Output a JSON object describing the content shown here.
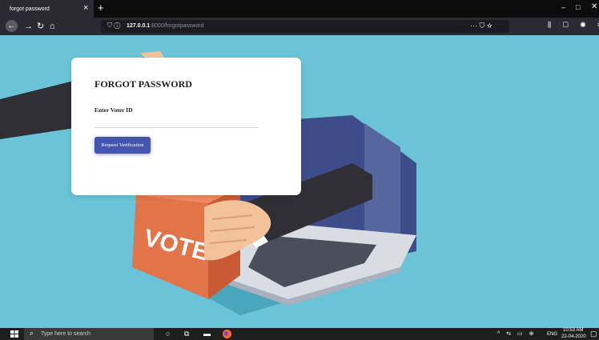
{
  "browser": {
    "tab_title": "forgot password",
    "tab_close_icon": "×",
    "new_tab_icon": "+",
    "url_host": "127.0.0.1",
    "url_rest": ":8000/forgotpassword",
    "window_controls": {
      "minimize": "–",
      "maximize": "□",
      "close": "✕"
    }
  },
  "nav": {
    "back_icon": "←",
    "forward_icon": "→",
    "reload_icon": "↻",
    "home_icon": "⌂",
    "url_prefix_icons": "⛉ ⓘ",
    "page_actions": "··· ⛉ ☆",
    "toolbar_right": "⫼ ▢ ◉ ≡"
  },
  "form": {
    "title": "FORGOT PASSWORD",
    "voter_label": "Enter Voter ID",
    "voter_value": "",
    "request_button": "Request Verification"
  },
  "illustration": {
    "box_text": "VOTE",
    "colors": {
      "background": "#6ac3d6",
      "ballot_box": "#e2744a",
      "ballot_box_side": "#c95a33",
      "laptop_screen": "#3e4d8a",
      "laptop_body": "#d9dde3",
      "sleeve": "#2f2f35",
      "skin": "#f2c29a",
      "shadow": "#4aa6bc"
    }
  },
  "taskbar": {
    "search_placeholder": "Type here to search",
    "search_icon": "⌕",
    "cortana_icon": "○",
    "task_view_icon": "⧉",
    "explorer_icon": "▬",
    "tray_icons": "^ ⇆ ▭ ⊕",
    "language": "ENG",
    "time": "10:53 AM",
    "date": "22-04-2020",
    "notifications_icon": "▢"
  }
}
